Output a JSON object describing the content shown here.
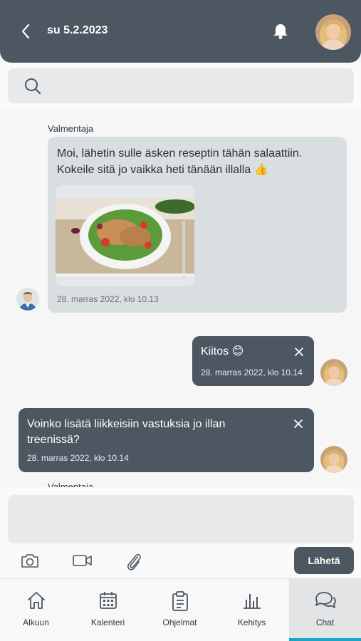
{
  "header": {
    "title": "su 5.2.2023"
  },
  "search": {
    "placeholder": ""
  },
  "messages": [
    {
      "sender": "Valmentaja",
      "text": "Moi, lähetin sulle äsken reseptin tähän salaattiin. Kokeile sitä jo vaikka heti tänään illalla 👍",
      "time": "28. marras 2022, klo 10.13"
    },
    {
      "text": "Kiitos 😊",
      "time": "28. marras 2022, klo 10.14"
    },
    {
      "text": "Voinko lisätä liikkeisiin vastuksia jo illan treenissä?",
      "time": "28. marras 2022, klo 10.14"
    },
    {
      "sender": "Valmentaja"
    }
  ],
  "composer": {
    "placeholder": "",
    "send_label": "Lähetä"
  },
  "tabs": [
    {
      "label": "Alkuun",
      "icon": "home-icon"
    },
    {
      "label": "Kalenteri",
      "icon": "calendar-icon"
    },
    {
      "label": "Ohjelmat",
      "icon": "clipboard-icon"
    },
    {
      "label": "Kehitys",
      "icon": "bar-chart-icon"
    },
    {
      "label": "Chat",
      "icon": "chat-icon",
      "active": true
    }
  ],
  "colors": {
    "header": "#4c5761",
    "incoming_bubble": "#d9dee1",
    "outgoing_bubble": "#4c5761",
    "active_tab_indicator": "#1aa5c8"
  }
}
